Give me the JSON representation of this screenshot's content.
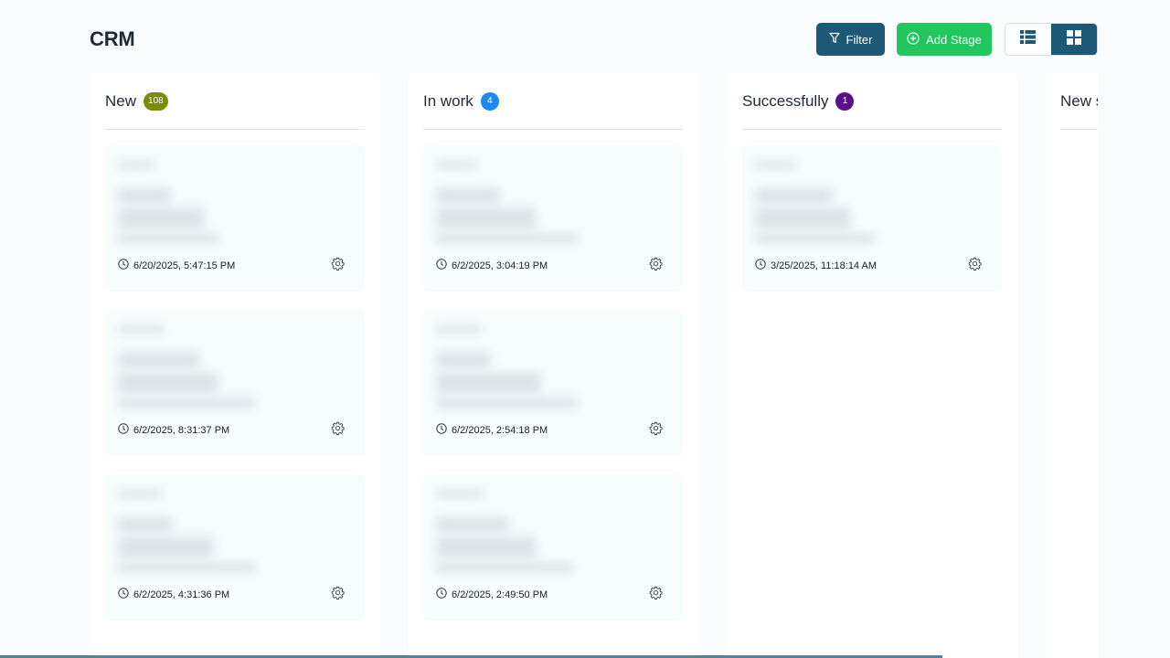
{
  "header": {
    "title": "CRM",
    "filter_label": "Filter",
    "add_stage_label": "Add Stage"
  },
  "colors": {
    "primary": "#1e5877",
    "success": "#22c55e",
    "badge_new": "#7a8a0c",
    "badge_inwork": "#1e88f0",
    "badge_success": "#5b0f8f"
  },
  "columns": [
    {
      "title": "New",
      "count": "108",
      "cards": [
        {
          "date": "6/20/2025, 5:47:15 PM"
        },
        {
          "date": "6/2/2025, 8:31:37 PM"
        },
        {
          "date": "6/2/2025, 4:31:36 PM"
        }
      ]
    },
    {
      "title": "In work",
      "count": "4",
      "cards": [
        {
          "date": "6/2/2025, 3:04:19 PM"
        },
        {
          "date": "6/2/2025, 2:54:18 PM"
        },
        {
          "date": "6/2/2025, 2:49:50 PM"
        }
      ]
    },
    {
      "title": "Successfully",
      "count": "1",
      "cards": [
        {
          "date": "3/25/2025, 11:18:14 AM"
        }
      ]
    },
    {
      "title": "New stage",
      "cards": []
    }
  ]
}
